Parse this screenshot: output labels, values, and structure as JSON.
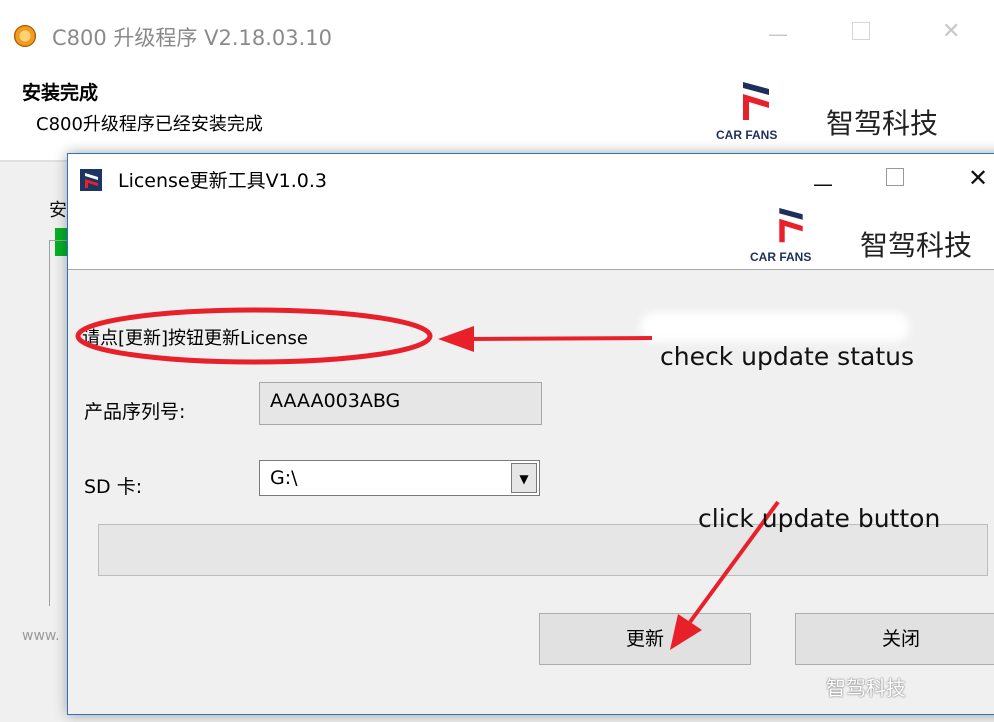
{
  "installer": {
    "title": "C800 升级程序 V2.18.03.10",
    "heading": "安装完成",
    "subheading": "C800升级程序已经安装完成",
    "partial_label": "安",
    "footer_text": "www."
  },
  "brand": {
    "logo_text": "CAR FANS",
    "name": "智驾科技"
  },
  "dialog": {
    "title": "License更新工具V1.0.3",
    "status_text": "请点[更新]按钮更新License",
    "serial_label": "产品序列号:",
    "serial_value": "AAAA003ABG",
    "sd_label": "SD 卡:",
    "sd_value": "G:\\",
    "progress": 0,
    "update_button": "更新",
    "close_button": "关闭"
  },
  "annotations": {
    "check_status": "check update status",
    "click_update": "click update button",
    "color": "#e8202a"
  },
  "watermark": "智驾科技",
  "colors": {
    "progress_green": "#06b025",
    "window_border": "#2b74c5",
    "brand_navy": "#1f2f5b",
    "brand_red": "#e8202a"
  }
}
